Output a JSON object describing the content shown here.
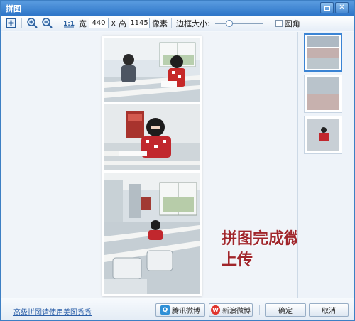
{
  "window": {
    "title": "拼图"
  },
  "toolbar": {
    "width_label": "宽",
    "width_value": "440",
    "height_label": "X 高",
    "height_value": "1145",
    "unit_label": "像素",
    "border_label": "边框大小:",
    "border_slider_level": 0.25,
    "rounded_label": "圆角",
    "rounded_checked": false
  },
  "canvas": {
    "caption_line1": "拼图完成微博",
    "caption_line2": "上传"
  },
  "thumbnails": [
    {
      "name": "layout-3-vertical",
      "selected": true
    },
    {
      "name": "layout-2-stacked",
      "selected": false
    },
    {
      "name": "layout-1-single",
      "selected": false
    }
  ],
  "bottom": {
    "advanced_link": "高级拼图请使用美图秀秀",
    "tencent_weibo": "腾讯微博",
    "sina_weibo": "新浪微博",
    "ok": "确定",
    "cancel": "取消"
  },
  "colors": {
    "title_bar": "#2f76c8",
    "caption": "#a0252b",
    "selected_thumb_border": "#3b84d4"
  }
}
